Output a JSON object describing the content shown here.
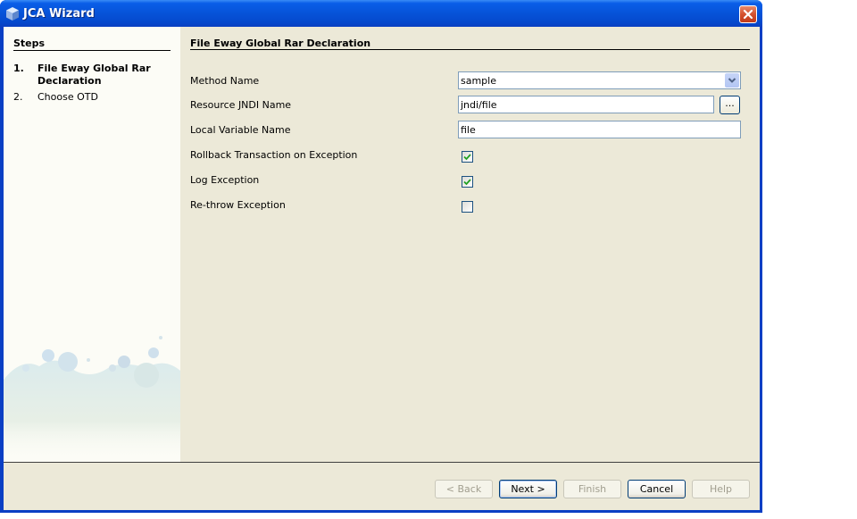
{
  "window": {
    "title": "JCA Wizard"
  },
  "steps": {
    "title": "Steps",
    "items": [
      {
        "number": "1.",
        "label": "File Eway Global Rar Declaration",
        "active": true
      },
      {
        "number": "2.",
        "label": "Choose OTD",
        "active": false
      }
    ]
  },
  "main": {
    "title": "File Eway Global Rar Declaration",
    "fields": {
      "method_name": {
        "label": "Method Name",
        "value": "sample"
      },
      "resource_jndi_name": {
        "label": "Resource JNDI Name",
        "value": "jndi/file",
        "browse_label": "..."
      },
      "local_variable_name": {
        "label": "Local Variable Name",
        "value": "file"
      }
    },
    "checkboxes": [
      {
        "label": "Rollback Transaction on Exception",
        "checked": true
      },
      {
        "label": "Log Exception",
        "checked": true
      },
      {
        "label": "Re-throw Exception",
        "checked": false
      }
    ]
  },
  "buttons": {
    "back": {
      "label": "< Back",
      "enabled": false
    },
    "next": {
      "label": "Next >",
      "enabled": true
    },
    "finish": {
      "label": "Finish",
      "enabled": false
    },
    "cancel": {
      "label": "Cancel",
      "enabled": true
    },
    "help": {
      "label": "Help",
      "enabled": false
    }
  },
  "colors": {
    "titlebar": "#0653d8",
    "dialog_bg": "#ece9d8",
    "check_mark": "#21a121",
    "close_button": "#d4512e"
  }
}
